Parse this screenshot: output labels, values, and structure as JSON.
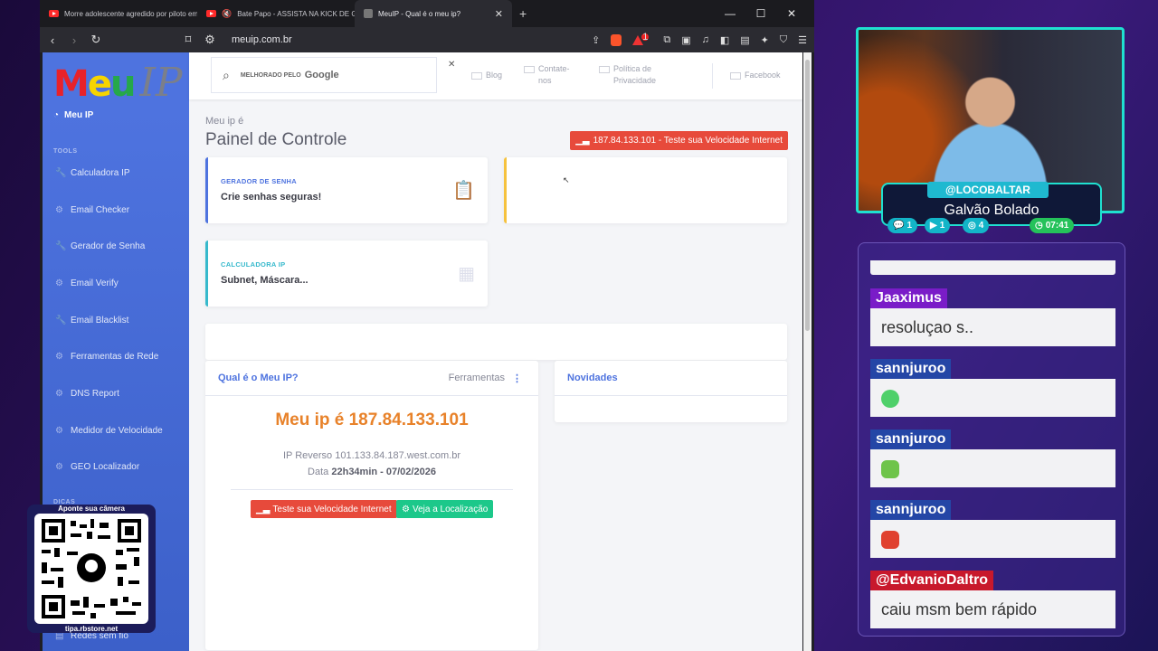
{
  "browser": {
    "tabs": [
      {
        "title": "Morre adolescente agredido por piloto em E",
        "type": "youtube"
      },
      {
        "title": "Bate Papo - ASSISTA NA KICK DE GRAÇ",
        "type": "youtube-muted"
      },
      {
        "title": "MeuIP - Qual é o meu ip?",
        "type": "active"
      }
    ],
    "new_tab": "+",
    "url": "meuip.com.br",
    "window_controls": [
      "—",
      "☐",
      "✕"
    ],
    "brave_badge": "1"
  },
  "site": {
    "logo_meu": [
      "M",
      "e",
      "u"
    ],
    "logo_ip": "IP",
    "home": "Meu IP",
    "sidebar_section_tools": "TOOLS",
    "sidebar_items": [
      "Calculadora IP",
      "Email Checker",
      "Gerador de Senha",
      "Email Verify",
      "Email Blacklist",
      "Ferramentas de Rede",
      "DNS Report",
      "Medidor de Velocidade",
      "GEO Localizador"
    ],
    "sidebar_section_tips": "DICAS",
    "sidebar_bottom_item": "Redes sem fio",
    "search": {
      "by": "MELHORADO PELO",
      "brand": "Google",
      "clear": "✕"
    },
    "top_links": [
      {
        "label": "Blog"
      },
      {
        "label": "Contate-\nnos"
      },
      {
        "label": "Política de\nPrivacidade"
      },
      {
        "label": "Facebook"
      }
    ],
    "breadcrumb": "Meu ip é",
    "page_title": "Painel de Controle",
    "speed_button": "187.84.133.101 - Teste sua Velocidade Internet",
    "card_password": {
      "kicker": "GERADOR DE SENHA",
      "text": "Crie senhas seguras!"
    },
    "card_calculator": {
      "kicker": "CALCULADORA IP",
      "text": "Subnet, Máscara..."
    },
    "panel_myip": {
      "title": "Qual é o Meu IP?",
      "tools_label": "Ferramentas",
      "ip_line": "Meu ip é 187.84.133.101",
      "reverse": "IP Reverso 101.133.84.187.west.com.br",
      "date_label": "Data",
      "date_value": "22h34min - 07/02/2026",
      "btn_speed": "Teste sua Velocidade Internet",
      "btn_location": "Veja a Localização"
    },
    "panel_news": {
      "title": "Novidades"
    }
  },
  "stream": {
    "handle": "@LOCOBALTAR",
    "name": "Galvão Bolado",
    "stats": [
      {
        "icon": "chat-icon",
        "value": "1"
      },
      {
        "icon": "youtube-icon",
        "value": "1"
      },
      {
        "icon": "viewers-icon",
        "value": "4"
      },
      {
        "icon": "clock-icon",
        "value": "07:41"
      }
    ],
    "chat": [
      {
        "user": "Jaaximus",
        "color": "purple",
        "text": "resoluçao s.."
      },
      {
        "user": "sannjuroo",
        "color": "blue",
        "emote": "#4fd06a"
      },
      {
        "user": "sannjuroo",
        "color": "blue",
        "emote": "#6ec44a"
      },
      {
        "user": "sannjuroo",
        "color": "blue",
        "emote": "#e0412f"
      },
      {
        "user": "@EdvanioDaltro",
        "color": "red",
        "text": "caiu msm bem rápido"
      }
    ],
    "qr": {
      "title": "Aponte sua câmera",
      "footer": "tipa.rbstore.net"
    }
  },
  "colors": {
    "sidebar": "#4e73df",
    "danger": "#e74a3b",
    "success": "#1cc88a",
    "ip_orange": "#e8822a",
    "overlay_cyan": "#1fe0d0"
  }
}
